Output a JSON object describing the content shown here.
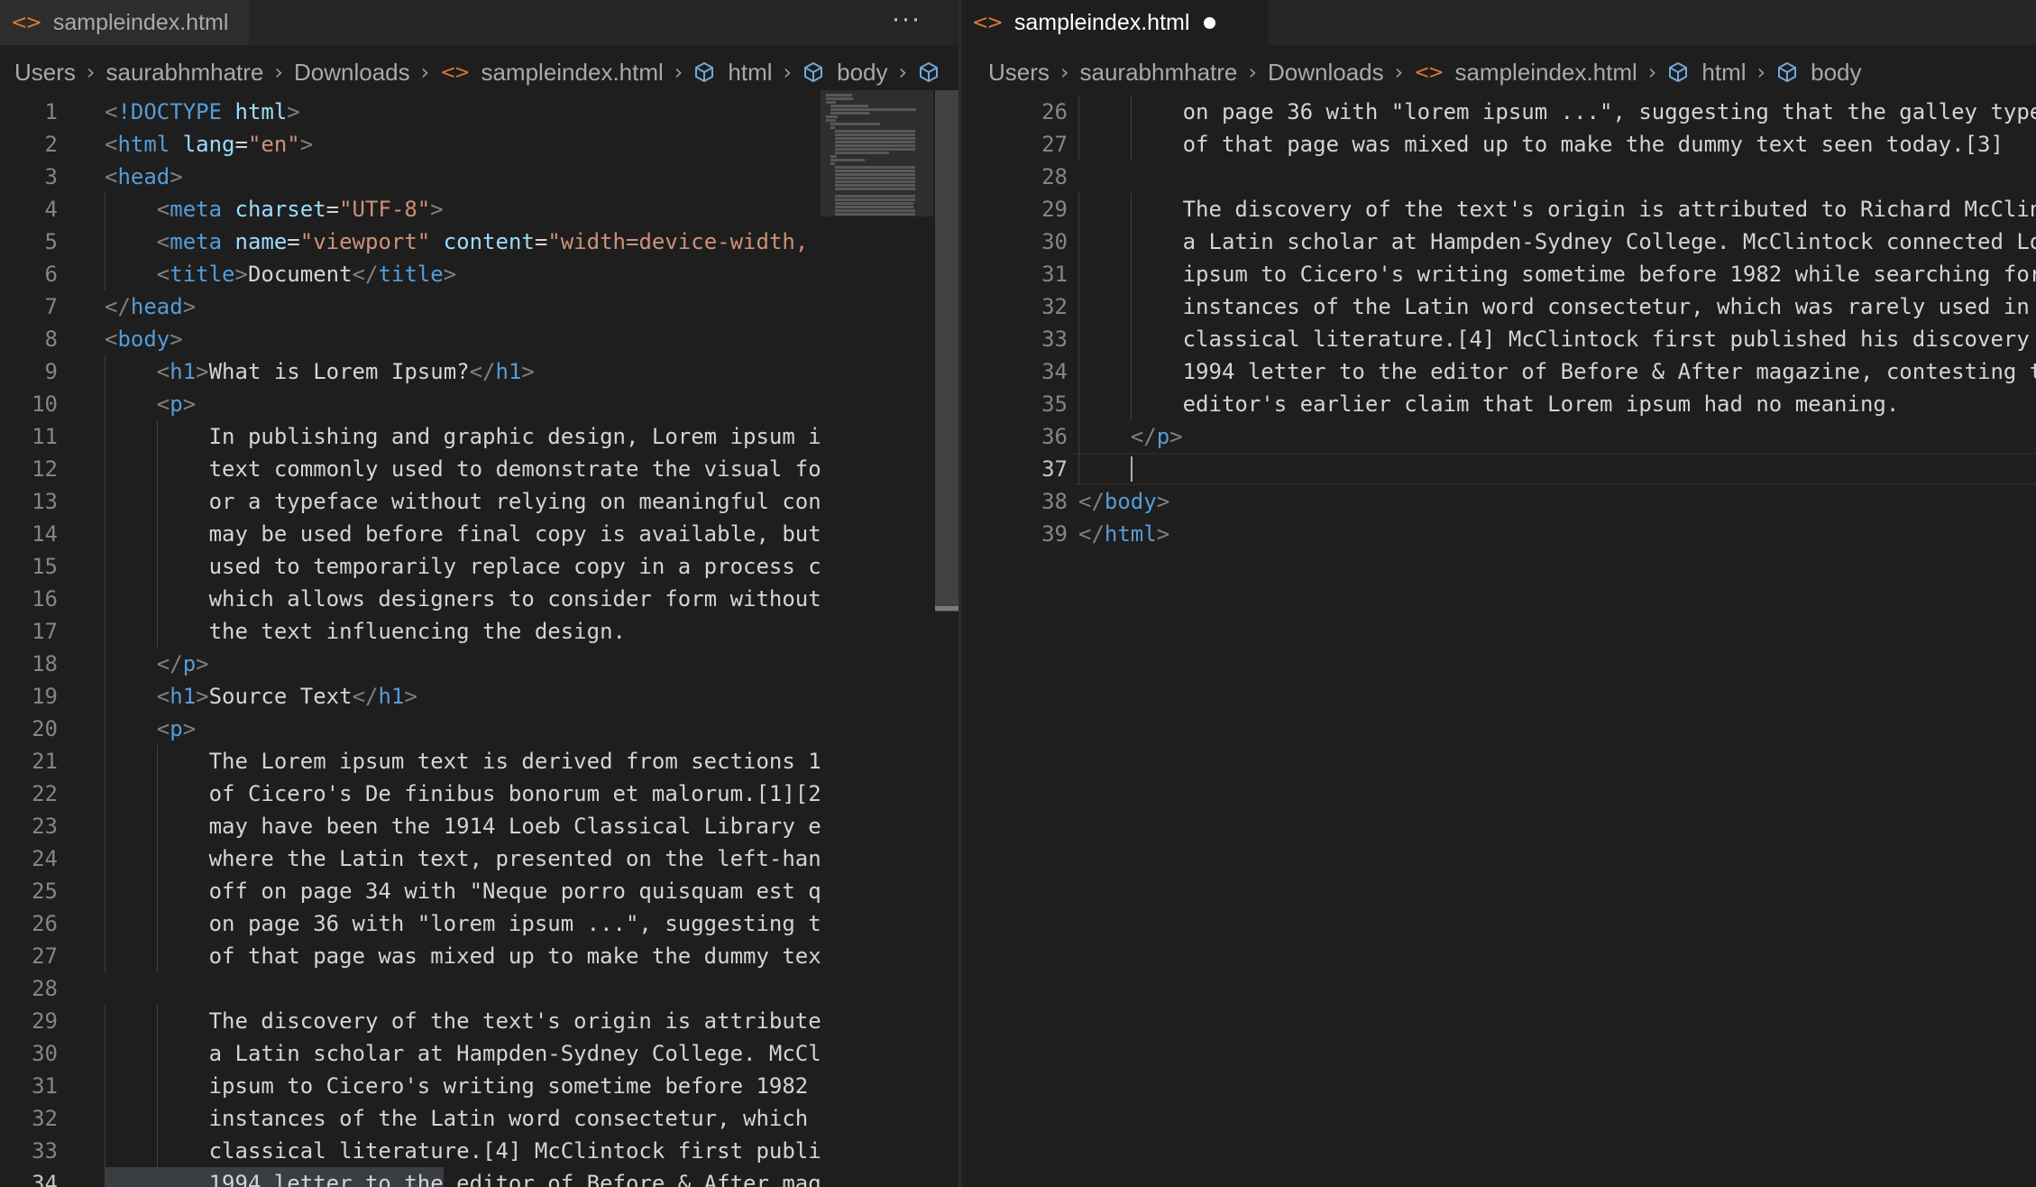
{
  "left_pane": {
    "tab": {
      "label": "sampleindex.html",
      "icon": "html-file-icon",
      "dirty": true
    },
    "more_actions": "···",
    "breadcrumb": [
      {
        "label": "Users",
        "icon": ""
      },
      {
        "label": "saurabhmhatre",
        "icon": ""
      },
      {
        "label": "Downloads",
        "icon": ""
      },
      {
        "label": "sampleindex.html",
        "icon": "code-icon"
      },
      {
        "label": "html",
        "icon": "symbol-element-icon"
      },
      {
        "label": "body",
        "icon": "symbol-element-icon"
      },
      {
        "label": "",
        "icon": "symbol-element-icon"
      }
    ],
    "first_line": 1,
    "highlighted_line": 34,
    "lines": [
      "<!DOCTYPE html>",
      "<html lang=\"en\">",
      "<head>",
      "    <meta charset=\"UTF-8\">",
      "    <meta name=\"viewport\" content=\"width=device-width, ",
      "    <title>Document</title>",
      "</head>",
      "<body>",
      "    <h1>What is Lorem Ipsum?</h1>",
      "    <p>",
      "        In publishing and graphic design, Lorem ipsum i",
      "        text commonly used to demonstrate the visual fo",
      "        or a typeface without relying on meaningful con",
      "        may be used before final copy is available, but",
      "        used to temporarily replace copy in a process c",
      "        which allows designers to consider form without",
      "        the text influencing the design.",
      "    </p>",
      "    <h1>Source Text</h1>",
      "    <p>",
      "        The Lorem ipsum text is derived from sections 1",
      "        of Cicero's De finibus bonorum et malorum.[1][2",
      "        may have been the 1914 Loeb Classical Library e",
      "        where the Latin text, presented on the left-han",
      "        off on page 34 with \"Neque porro quisquam est q",
      "        on page 36 with \"lorem ipsum ...\", suggesting t",
      "        of that page was mixed up to make the dummy tex",
      "",
      "        The discovery of the text's origin is attribute",
      "        a Latin scholar at Hampden-Sydney College. McCl",
      "        ipsum to Cicero's writing sometime before 1982 ",
      "        instances of the Latin word consectetur, which ",
      "        classical literature.[4] McClintock first publi",
      "        1994 letter to the editor of Before & After mag"
    ]
  },
  "right_pane": {
    "tab": {
      "label": "sampleindex.html",
      "icon": "html-file-icon",
      "dirty": true
    },
    "breadcrumb": [
      {
        "label": "Users",
        "icon": ""
      },
      {
        "label": "saurabhmhatre",
        "icon": ""
      },
      {
        "label": "Downloads",
        "icon": ""
      },
      {
        "label": "sampleindex.html",
        "icon": "code-icon"
      },
      {
        "label": "html",
        "icon": "symbol-element-icon"
      },
      {
        "label": "body",
        "icon": "symbol-element-icon"
      }
    ],
    "first_line": 26,
    "cursor_line": 37,
    "lines": [
      "        on page 36 with \"lorem ipsum ...\", suggesting that the galley type",
      "        of that page was mixed up to make the dummy text seen today.[3]",
      "",
      "        The discovery of the text's origin is attributed to Richard McClin",
      "        a Latin scholar at Hampden-Sydney College. McClintock connected Lo",
      "        ipsum to Cicero's writing sometime before 1982 while searching for",
      "        instances of the Latin word consectetur, which was rarely used in ",
      "        classical literature.[4] McClintock first published his discovery ",
      "        1994 letter to the editor of Before & After magazine, contesting t",
      "        editor's earlier claim that Lorem ipsum had no meaning.",
      "    </p>",
      "    ",
      "</body>",
      "</html>"
    ]
  },
  "colors": {
    "background": "#1e1e1e",
    "tag_name": "#569cd6",
    "attribute": "#9cdcfe",
    "string": "#ce9178",
    "bracket": "#808080",
    "text": "#d4d4d4",
    "line_number": "#858585",
    "file_icon": "#e37933"
  }
}
